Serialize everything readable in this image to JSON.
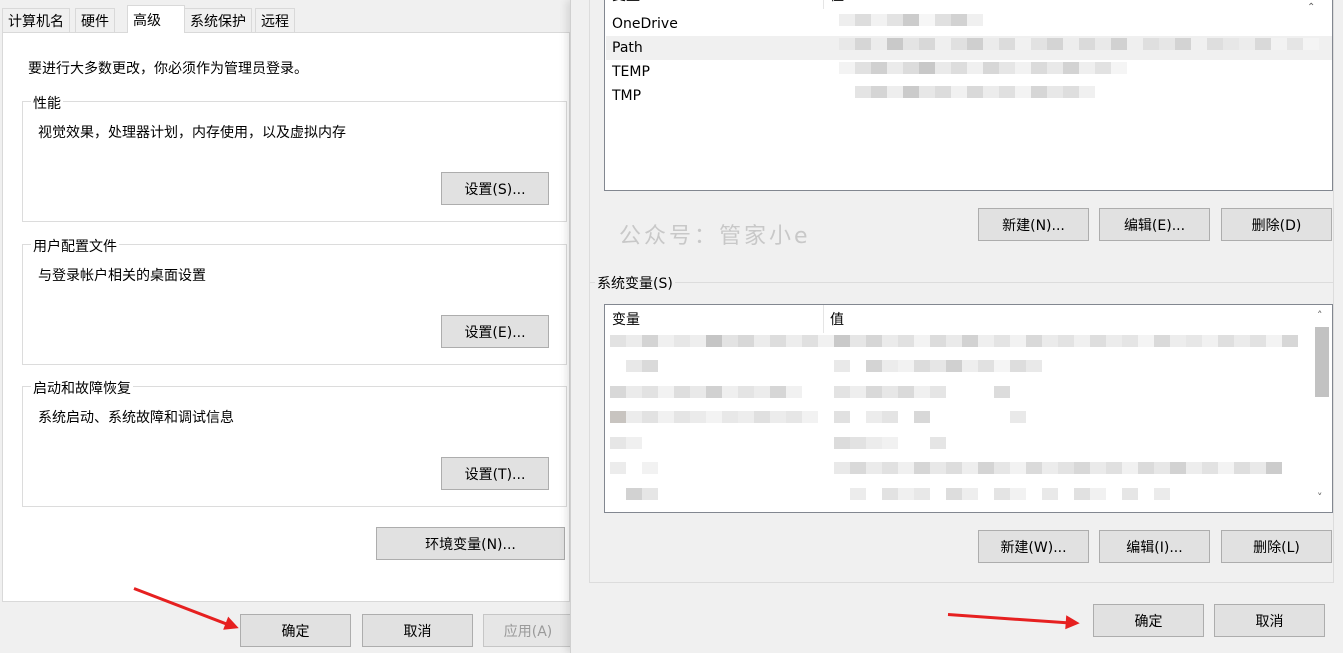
{
  "left_dialog": {
    "tabs": [
      "计算机名",
      "硬件",
      "高级",
      "系统保护",
      "远程"
    ],
    "notice": "要进行大多数更改，你必须作为管理员登录。",
    "groups": [
      {
        "title": "性能",
        "desc": "视觉效果，处理器计划，内存使用，以及虚拟内存",
        "button": "设置(S)..."
      },
      {
        "title": "用户配置文件",
        "desc": "与登录帐户相关的桌面设置",
        "button": "设置(E)..."
      },
      {
        "title": "启动和故障恢复",
        "desc": "系统启动、系统故障和调试信息",
        "button": "设置(T)..."
      }
    ],
    "env_button": "环境变量(N)...",
    "ok": "确定",
    "cancel": "取消",
    "apply": "应用(A)"
  },
  "env_dialog": {
    "user_vars": {
      "col_var": "变量",
      "col_val": "值",
      "rows": [
        "OneDrive",
        "Path",
        "TEMP",
        "TMP"
      ]
    },
    "user_buttons": {
      "new": "新建(N)...",
      "edit": "编辑(E)...",
      "delete": "删除(D)"
    },
    "watermark": "公众号：管家小e",
    "system_label": "系统变量(S)",
    "system_vars": {
      "col_var": "变量",
      "col_val": "值"
    },
    "system_buttons": {
      "new": "新建(W)...",
      "edit": "编辑(I)...",
      "delete": "删除(L)"
    },
    "ok": "确定",
    "cancel": "取消"
  },
  "colors": {
    "arrow": "#e62020",
    "selected_row": "#f0f0f0"
  }
}
